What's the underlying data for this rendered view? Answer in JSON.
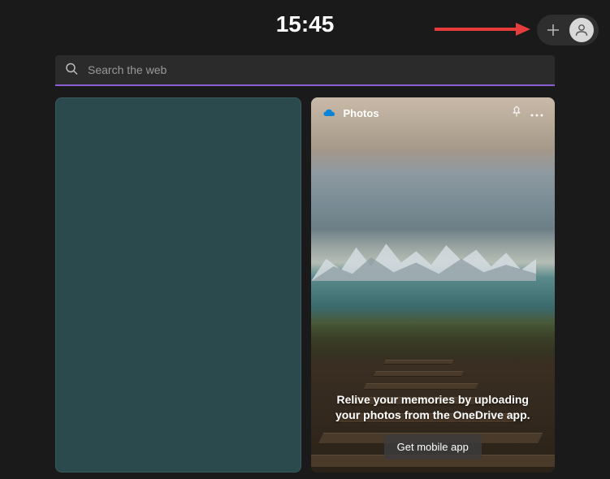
{
  "header": {
    "time": "15:45"
  },
  "search": {
    "placeholder": "Search the web"
  },
  "widgets": {
    "photos": {
      "title": "Photos",
      "caption": "Relive your memories by uploading your photos from the OneDrive app.",
      "button_label": "Get mobile app"
    }
  },
  "colors": {
    "accent": "#8a5fd4",
    "background": "#1a1a1a",
    "arrow": "#e73c3c"
  }
}
